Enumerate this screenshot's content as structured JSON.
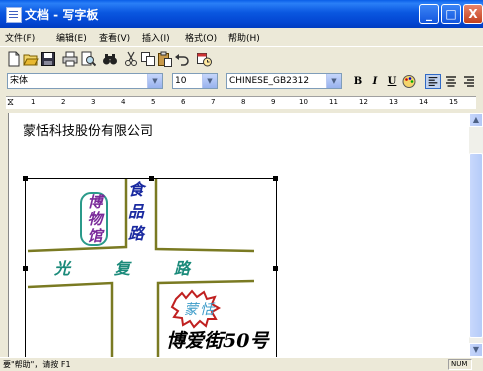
{
  "window": {
    "title": "文档 - 写字板"
  },
  "title_buttons": {
    "minimize": "_",
    "maximize": "□",
    "close": "X"
  },
  "menu": [
    "文件(F)",
    "编辑(E)",
    "查看(V)",
    "插入(I)",
    "格式(O)",
    "帮助(H)"
  ],
  "toolbar": {
    "icons": [
      "new-icon",
      "open-icon",
      "save-icon",
      "print-icon",
      "print-preview-icon",
      "find-icon",
      "cut-icon",
      "copy-icon",
      "paste-icon",
      "undo-icon",
      "insert-datetime-icon"
    ]
  },
  "format": {
    "font": "宋体",
    "size": "10",
    "charset": "CHINESE_GB2312",
    "bold": "B",
    "italic": "I",
    "underline": "U",
    "align_left_active": true
  },
  "ruler": {
    "numbers": [
      "1",
      "2",
      "3",
      "4",
      "5",
      "6",
      "7",
      "8",
      "9",
      "10",
      "11",
      "12",
      "13",
      "14",
      "15"
    ]
  },
  "document": {
    "heading": "蒙恬科技股份有限公司",
    "drawing": {
      "library_label": "博物馆",
      "vertical_road": "食品路",
      "horizontal_road": "光复路",
      "company": "蒙恬",
      "address": "博爱街50号"
    }
  },
  "status": {
    "hint": "要\"帮助\"，请按 F1",
    "num": "NUM"
  }
}
